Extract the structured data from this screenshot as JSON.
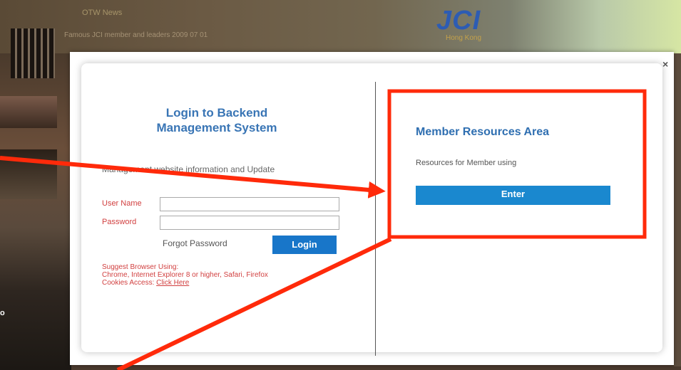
{
  "background": {
    "news_tag": "OTW News",
    "news_line": "Famous JCI member and leaders 2009 07 01",
    "logo_text": "JCI",
    "logo_sub": "Hong Kong",
    "side_text": "o"
  },
  "modal": {
    "close_label": "×",
    "login": {
      "title": "Login to Backend Management System",
      "description": "Management website information and Update",
      "username_label": "User Name",
      "password_label": "Password",
      "username_value": "",
      "password_value": "",
      "forgot_label": "Forgot Password",
      "login_button": "Login",
      "note_line1": "Suggest Browser Using:",
      "note_line2": "Chrome, Internet Explorer 8 or higher, Safari, Firefox",
      "note_line3_prefix": "Cookies Access: ",
      "note_link": "Click Here"
    },
    "resources": {
      "title": "Member Resources Area",
      "description": "Resources for Member using",
      "enter_button": "Enter"
    }
  },
  "annotation": {
    "color": "#ff2a0a"
  }
}
